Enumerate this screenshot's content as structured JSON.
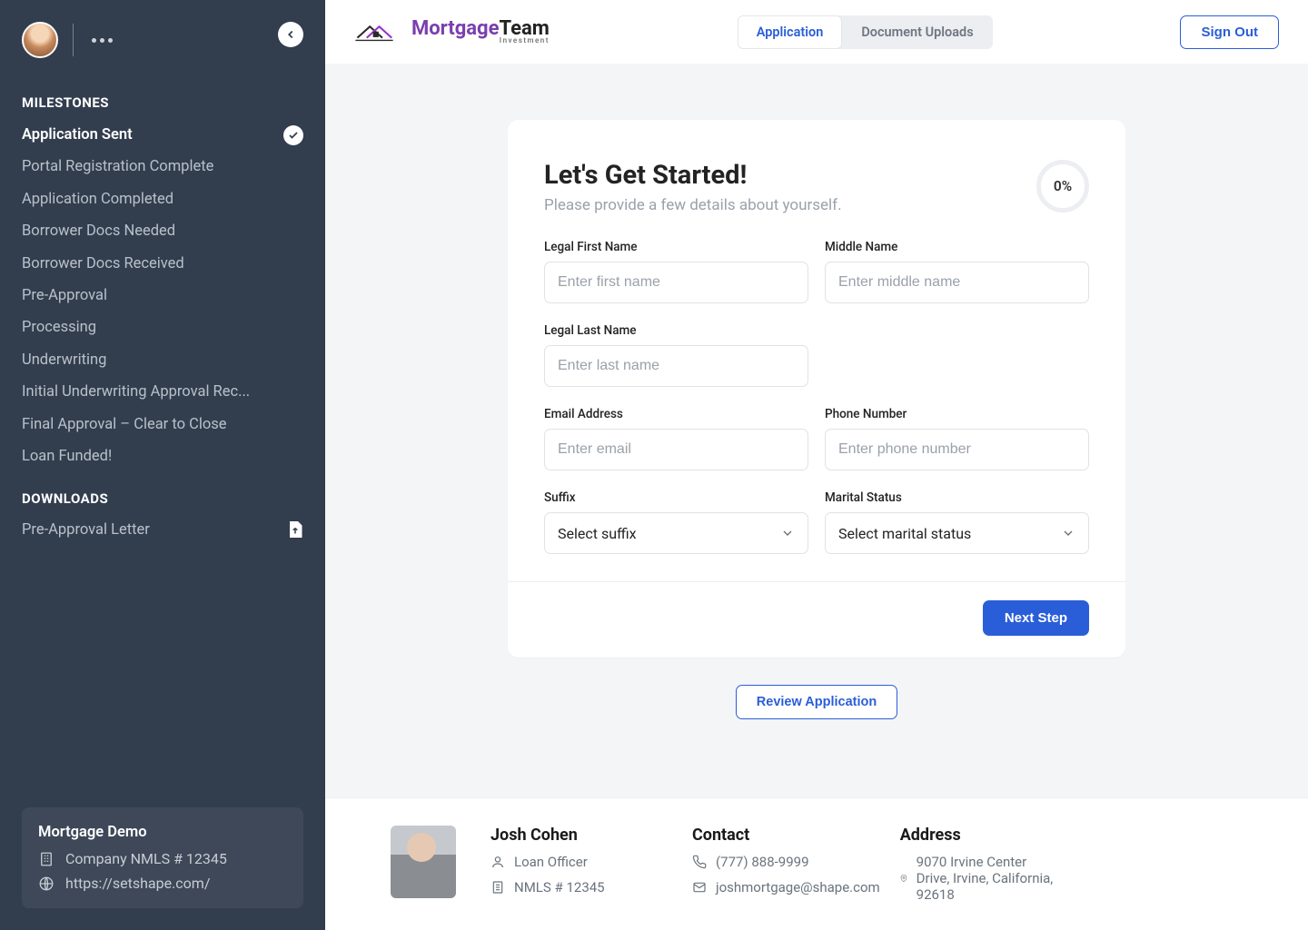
{
  "sidebar": {
    "sections": {
      "milestones": {
        "title": "MILESTONES",
        "items": [
          {
            "label": "Application Sent",
            "active": true
          },
          {
            "label": "Portal Registration Complete"
          },
          {
            "label": "Application Completed"
          },
          {
            "label": "Borrower Docs Needed"
          },
          {
            "label": "Borrower Docs Received"
          },
          {
            "label": "Pre-Approval"
          },
          {
            "label": "Processing"
          },
          {
            "label": "Underwriting"
          },
          {
            "label": "Initial Underwriting Approval Rec..."
          },
          {
            "label": "Final Approval – Clear to Close"
          },
          {
            "label": "Loan Funded!"
          }
        ]
      },
      "downloads": {
        "title": "DOWNLOADS",
        "items": [
          {
            "label": "Pre-Approval Letter"
          }
        ]
      }
    },
    "company": {
      "name": "Mortgage Demo",
      "nmls": "Company NMLS # 12345",
      "url": "https://setshape.com/"
    }
  },
  "topbar": {
    "logo": {
      "line1a": "Mortgage",
      "line1b": "Team",
      "sub": "Investment"
    },
    "tabs": [
      {
        "label": "Application",
        "active": true
      },
      {
        "label": "Document Uploads"
      }
    ],
    "signout": "Sign Out"
  },
  "form": {
    "heading": "Let's Get Started!",
    "sub": "Please provide a few details about yourself.",
    "progress": "0%",
    "fields": {
      "first": {
        "label": "Legal First Name",
        "placeholder": "Enter first name"
      },
      "middle": {
        "label": "Middle Name",
        "placeholder": "Enter middle name"
      },
      "last": {
        "label": "Legal Last Name",
        "placeholder": "Enter last name"
      },
      "email": {
        "label": "Email Address",
        "placeholder": "Enter email"
      },
      "phone": {
        "label": "Phone Number",
        "placeholder": "Enter phone number"
      },
      "suffix": {
        "label": "Suffix",
        "placeholder": "Select suffix"
      },
      "marital": {
        "label": "Marital Status",
        "placeholder": "Select marital status"
      }
    },
    "next_label": "Next Step"
  },
  "review_label": "Review Application",
  "footer": {
    "agent": {
      "name": "Josh Cohen",
      "role": "Loan Officer",
      "nmls": "NMLS # 12345"
    },
    "contact": {
      "title": "Contact",
      "phone": "(777) 888-9999",
      "email": "joshmortgage@shape.com"
    },
    "address": {
      "title": "Address",
      "text": "9070 Irvine Center Drive, Irvine, California, 92618"
    }
  }
}
